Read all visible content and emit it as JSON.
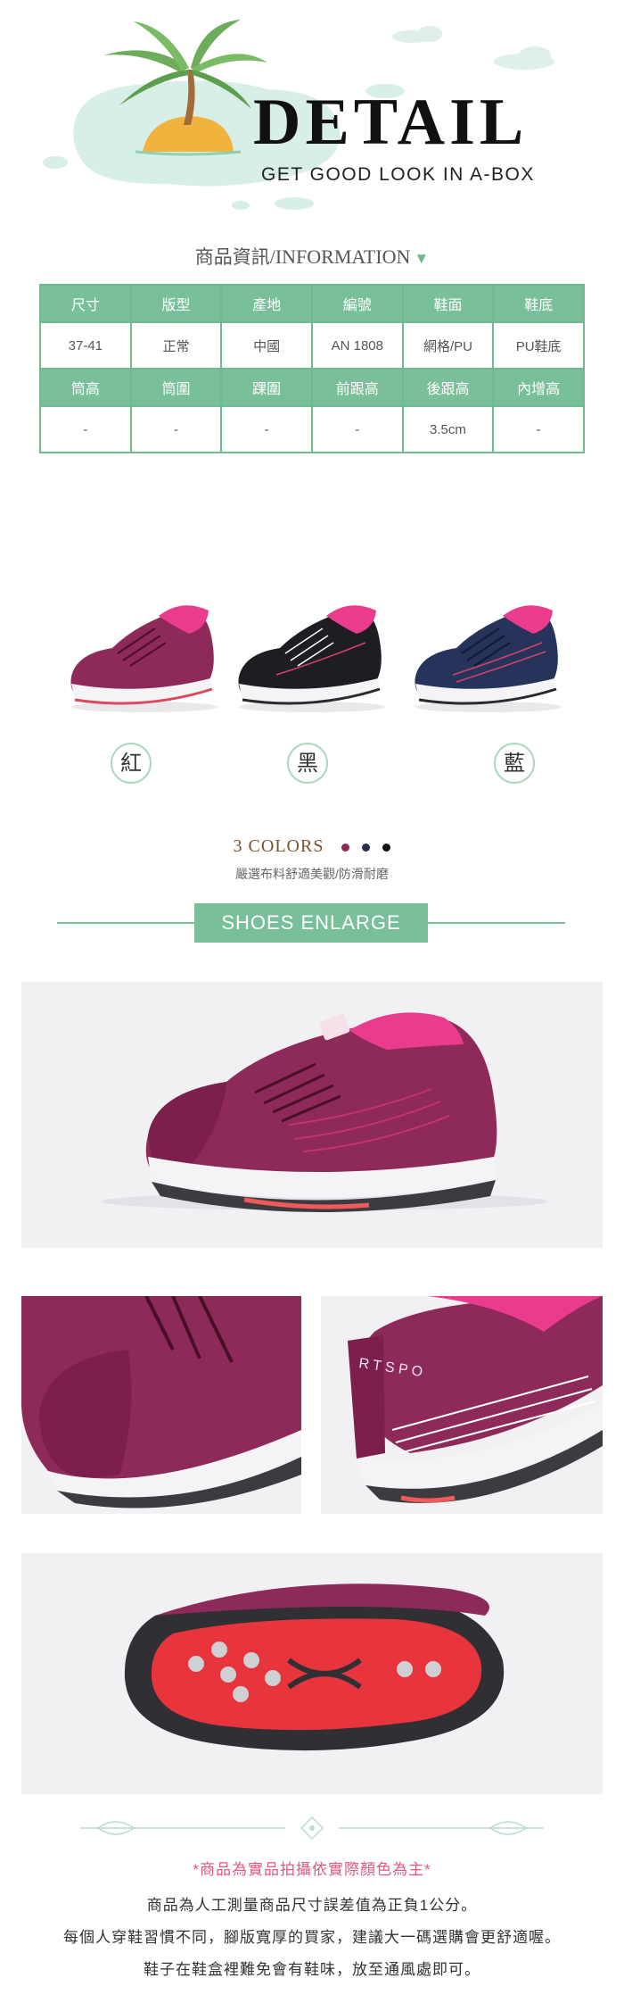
{
  "hero": {
    "title": "DETAIL",
    "subtitle": "GET GOOD LOOK IN A-BOX"
  },
  "info": {
    "heading_zh": "商品資訊",
    "heading_en": "/INFORMATION",
    "marker": "▼"
  },
  "spec_table": {
    "row1_headers": [
      "尺寸",
      "版型",
      "產地",
      "編號",
      "鞋面",
      "鞋底"
    ],
    "row1_values": [
      "37-41",
      "正常",
      "中國",
      "AN 1808",
      "網格/PU",
      "PU鞋底"
    ],
    "row2_headers": [
      "筒高",
      "筒圍",
      "踝圍",
      "前跟高",
      "後跟高",
      "內增高"
    ],
    "row2_values": [
      "-",
      "-",
      "-",
      "-",
      "3.5cm",
      "-"
    ]
  },
  "colors": {
    "labels": [
      "紅",
      "黑",
      "藍"
    ],
    "title": "3 COLORS",
    "dot_colors": [
      "#8a2a57",
      "#2a2f4f",
      "#111111"
    ],
    "description": "嚴選布料舒適美觀/防滑耐磨"
  },
  "theme": {
    "accent": "#79c09a",
    "note_red": "#e3597e"
  },
  "enlarge": {
    "label": "SHOES ENLARGE"
  },
  "photo_text": {
    "heel_print": "R T S P O"
  },
  "notes": {
    "red": "*商品為實品拍攝依實際顏色為主*",
    "line1": "商品為人工測量商品尺寸誤差值為正負1公分。",
    "line2": "每個人穿鞋習慣不同，腳版寬厚的買家，建議大一碼選購會更舒適喔。",
    "line3": "鞋子在鞋盒裡難免會有鞋味，放至通風處即可。"
  }
}
